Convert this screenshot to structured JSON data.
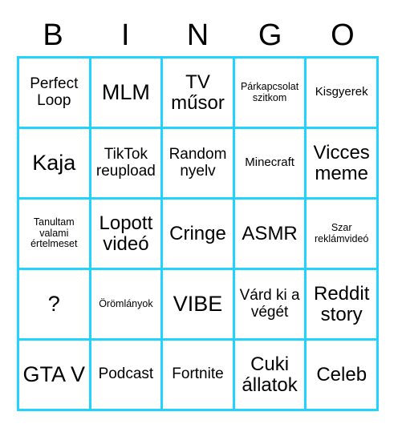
{
  "card": {
    "title": "BINGO",
    "grid_line_color": "#22d3ff",
    "text_color": "#000000",
    "background_color": "#ffffff",
    "columns": 5,
    "rows": 5
  },
  "header": {
    "letters": [
      {
        "label": "B"
      },
      {
        "label": "I"
      },
      {
        "label": "N"
      },
      {
        "label": "G"
      },
      {
        "label": "O"
      }
    ]
  },
  "cells": [
    {
      "label": "Perfect Loop",
      "size": "md"
    },
    {
      "label": "MLM",
      "size": "xl"
    },
    {
      "label": "TV műsor",
      "size": "lg"
    },
    {
      "label": "Párkapcsolat szitkom",
      "size": "xs"
    },
    {
      "label": "Kisgyerek",
      "size": "sm"
    },
    {
      "label": "Kaja",
      "size": "xl"
    },
    {
      "label": "TikTok reupload",
      "size": "md"
    },
    {
      "label": "Random nyelv",
      "size": "md"
    },
    {
      "label": "Minecraft",
      "size": "sm"
    },
    {
      "label": "Vicces meme",
      "size": "lg"
    },
    {
      "label": "Tanultam valami értelmeset",
      "size": "xs"
    },
    {
      "label": "Lopott videó",
      "size": "lg"
    },
    {
      "label": "Cringe",
      "size": "lg"
    },
    {
      "label": "ASMR",
      "size": "lg"
    },
    {
      "label": "Szar reklámvideó",
      "size": "xs"
    },
    {
      "label": "?",
      "size": "xl"
    },
    {
      "label": "Örömlányok",
      "size": "xs"
    },
    {
      "label": "VIBE",
      "size": "xl"
    },
    {
      "label": "Várd ki a végét",
      "size": "md"
    },
    {
      "label": "Reddit story",
      "size": "lg"
    },
    {
      "label": "GTA V",
      "size": "xl"
    },
    {
      "label": "Podcast",
      "size": "md"
    },
    {
      "label": "Fortnite",
      "size": "md"
    },
    {
      "label": "Cuki állatok",
      "size": "lg"
    },
    {
      "label": "Celeb",
      "size": "lg"
    }
  ]
}
